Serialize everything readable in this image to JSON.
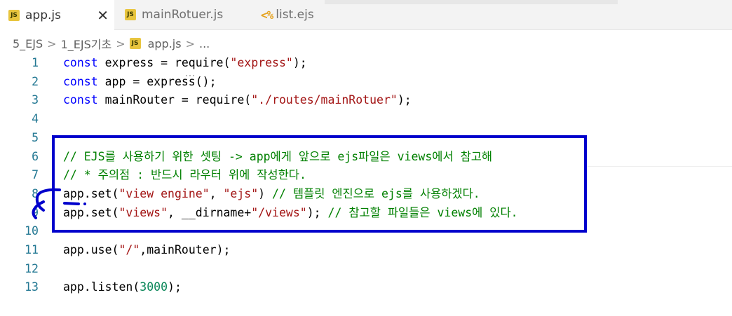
{
  "tabs": [
    {
      "label": "app.js",
      "icon": "js-file-icon",
      "active": true
    },
    {
      "label": "mainRotuer.js",
      "icon": "js-file-icon",
      "active": false
    },
    {
      "label": "list.ejs",
      "icon": "ejs-file-icon",
      "active": false
    }
  ],
  "icons": {
    "js_badge": "JS",
    "ejs_badge": "<%",
    "close": "✕"
  },
  "breadcrumb": {
    "items": [
      "5_EJS",
      "1_EJS기초",
      "app.js",
      "..."
    ],
    "separator": ">"
  },
  "colors": {
    "keyword": "#0000ff",
    "string": "#a31515",
    "number": "#098658",
    "comment": "#008000",
    "line_number": "#237893",
    "annotation": "#0000cc"
  },
  "editor": {
    "lines": [
      {
        "n": "1",
        "tokens": [
          {
            "t": "const",
            "c": "kw"
          },
          {
            "t": " express = require(",
            "c": ""
          },
          {
            "t": "\"express\"",
            "c": "str"
          },
          {
            "t": ");",
            "c": ""
          }
        ]
      },
      {
        "n": "2",
        "tokens": [
          {
            "t": "const",
            "c": "kw"
          },
          {
            "t": " app = express();",
            "c": ""
          }
        ]
      },
      {
        "n": "3",
        "tokens": [
          {
            "t": "const",
            "c": "kw"
          },
          {
            "t": " mainRouter = require(",
            "c": ""
          },
          {
            "t": "\"./routes/mainRotuer\"",
            "c": "str"
          },
          {
            "t": ");",
            "c": ""
          }
        ]
      },
      {
        "n": "4",
        "tokens": []
      },
      {
        "n": "5",
        "tokens": []
      },
      {
        "n": "6",
        "tokens": [
          {
            "t": "// EJS를 사용하기 위한 셋팅 -> app에게 앞으로 ejs파일은 views에서 참고해",
            "c": "cmt"
          }
        ]
      },
      {
        "n": "7",
        "tokens": [
          {
            "t": "// * 주의점 : 반드시 라우터 위에 작성한다.",
            "c": "cmt"
          }
        ]
      },
      {
        "n": "8",
        "tokens": [
          {
            "t": "app.set(",
            "c": ""
          },
          {
            "t": "\"view engine\"",
            "c": "str"
          },
          {
            "t": ", ",
            "c": ""
          },
          {
            "t": "\"ejs\"",
            "c": "str"
          },
          {
            "t": ") ",
            "c": ""
          },
          {
            "t": "// 템플릿 엔진으로 ejs를 사용하겠다.",
            "c": "cmt"
          }
        ]
      },
      {
        "n": "9",
        "tokens": [
          {
            "t": "app.set(",
            "c": ""
          },
          {
            "t": "\"views\"",
            "c": "str"
          },
          {
            "t": ", __dirname+",
            "c": ""
          },
          {
            "t": "\"/views\"",
            "c": "str"
          },
          {
            "t": "); ",
            "c": ""
          },
          {
            "t": "// 참고할 파일들은 views에 있다.",
            "c": "cmt"
          }
        ]
      },
      {
        "n": "10",
        "tokens": []
      },
      {
        "n": "11",
        "tokens": [
          {
            "t": "app.use(",
            "c": ""
          },
          {
            "t": "\"/\"",
            "c": "str"
          },
          {
            "t": ",mainRouter);",
            "c": ""
          }
        ]
      },
      {
        "n": "12",
        "tokens": []
      },
      {
        "n": "13",
        "tokens": [
          {
            "t": "app.listen(",
            "c": ""
          },
          {
            "t": "3000",
            "c": "num"
          },
          {
            "t": ");",
            "c": ""
          }
        ]
      }
    ]
  }
}
